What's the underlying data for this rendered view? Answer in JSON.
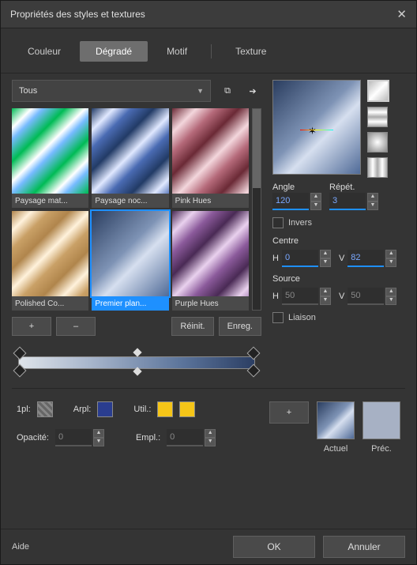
{
  "title": "Propriétés des styles et textures",
  "tabs": {
    "color": "Couleur",
    "gradient": "Dégradé",
    "pattern": "Motif",
    "texture": "Texture",
    "active": "gradient"
  },
  "category": {
    "selected": "Tous"
  },
  "icons": {
    "copy": "⧉",
    "arrow": "➔"
  },
  "thumbs": [
    {
      "label": "Paysage mat...",
      "cls": "g-green"
    },
    {
      "label": "Paysage noc...",
      "cls": "g-blue"
    },
    {
      "label": "Pink Hues",
      "cls": "g-red"
    },
    {
      "label": "Polished Co...",
      "cls": "g-copper"
    },
    {
      "label": "Premier plan...",
      "cls": "g-fg",
      "selected": true
    },
    {
      "label": "Purple Hues",
      "cls": "g-purple"
    }
  ],
  "btn": {
    "add": "+",
    "remove": "–",
    "reset": "Réinit.",
    "save": "Enreg."
  },
  "panel": {
    "angleLabel": "Angle",
    "angle": "120",
    "repeatLabel": "Répét.",
    "repeat": "3",
    "invertLabel": "Invers",
    "centerLabel": "Centre",
    "centerH": "0",
    "centerV": "82",
    "sourceLabel": "Source",
    "sourceH": "50",
    "sourceV": "50",
    "linkLabel": "Liaison",
    "H": "H",
    "V": "V"
  },
  "lower": {
    "fgLabel": "1pl:",
    "bgLabel": "Arpl:",
    "utilLabel": "Util.:",
    "opacityLabel": "Opacité:",
    "opacity": "0",
    "posLabel": "Empl.:",
    "pos": "0",
    "addStop": "+",
    "currentLabel": "Actuel",
    "prevLabel": "Préc."
  },
  "footer": {
    "help": "Aide",
    "ok": "OK",
    "cancel": "Annuler"
  }
}
